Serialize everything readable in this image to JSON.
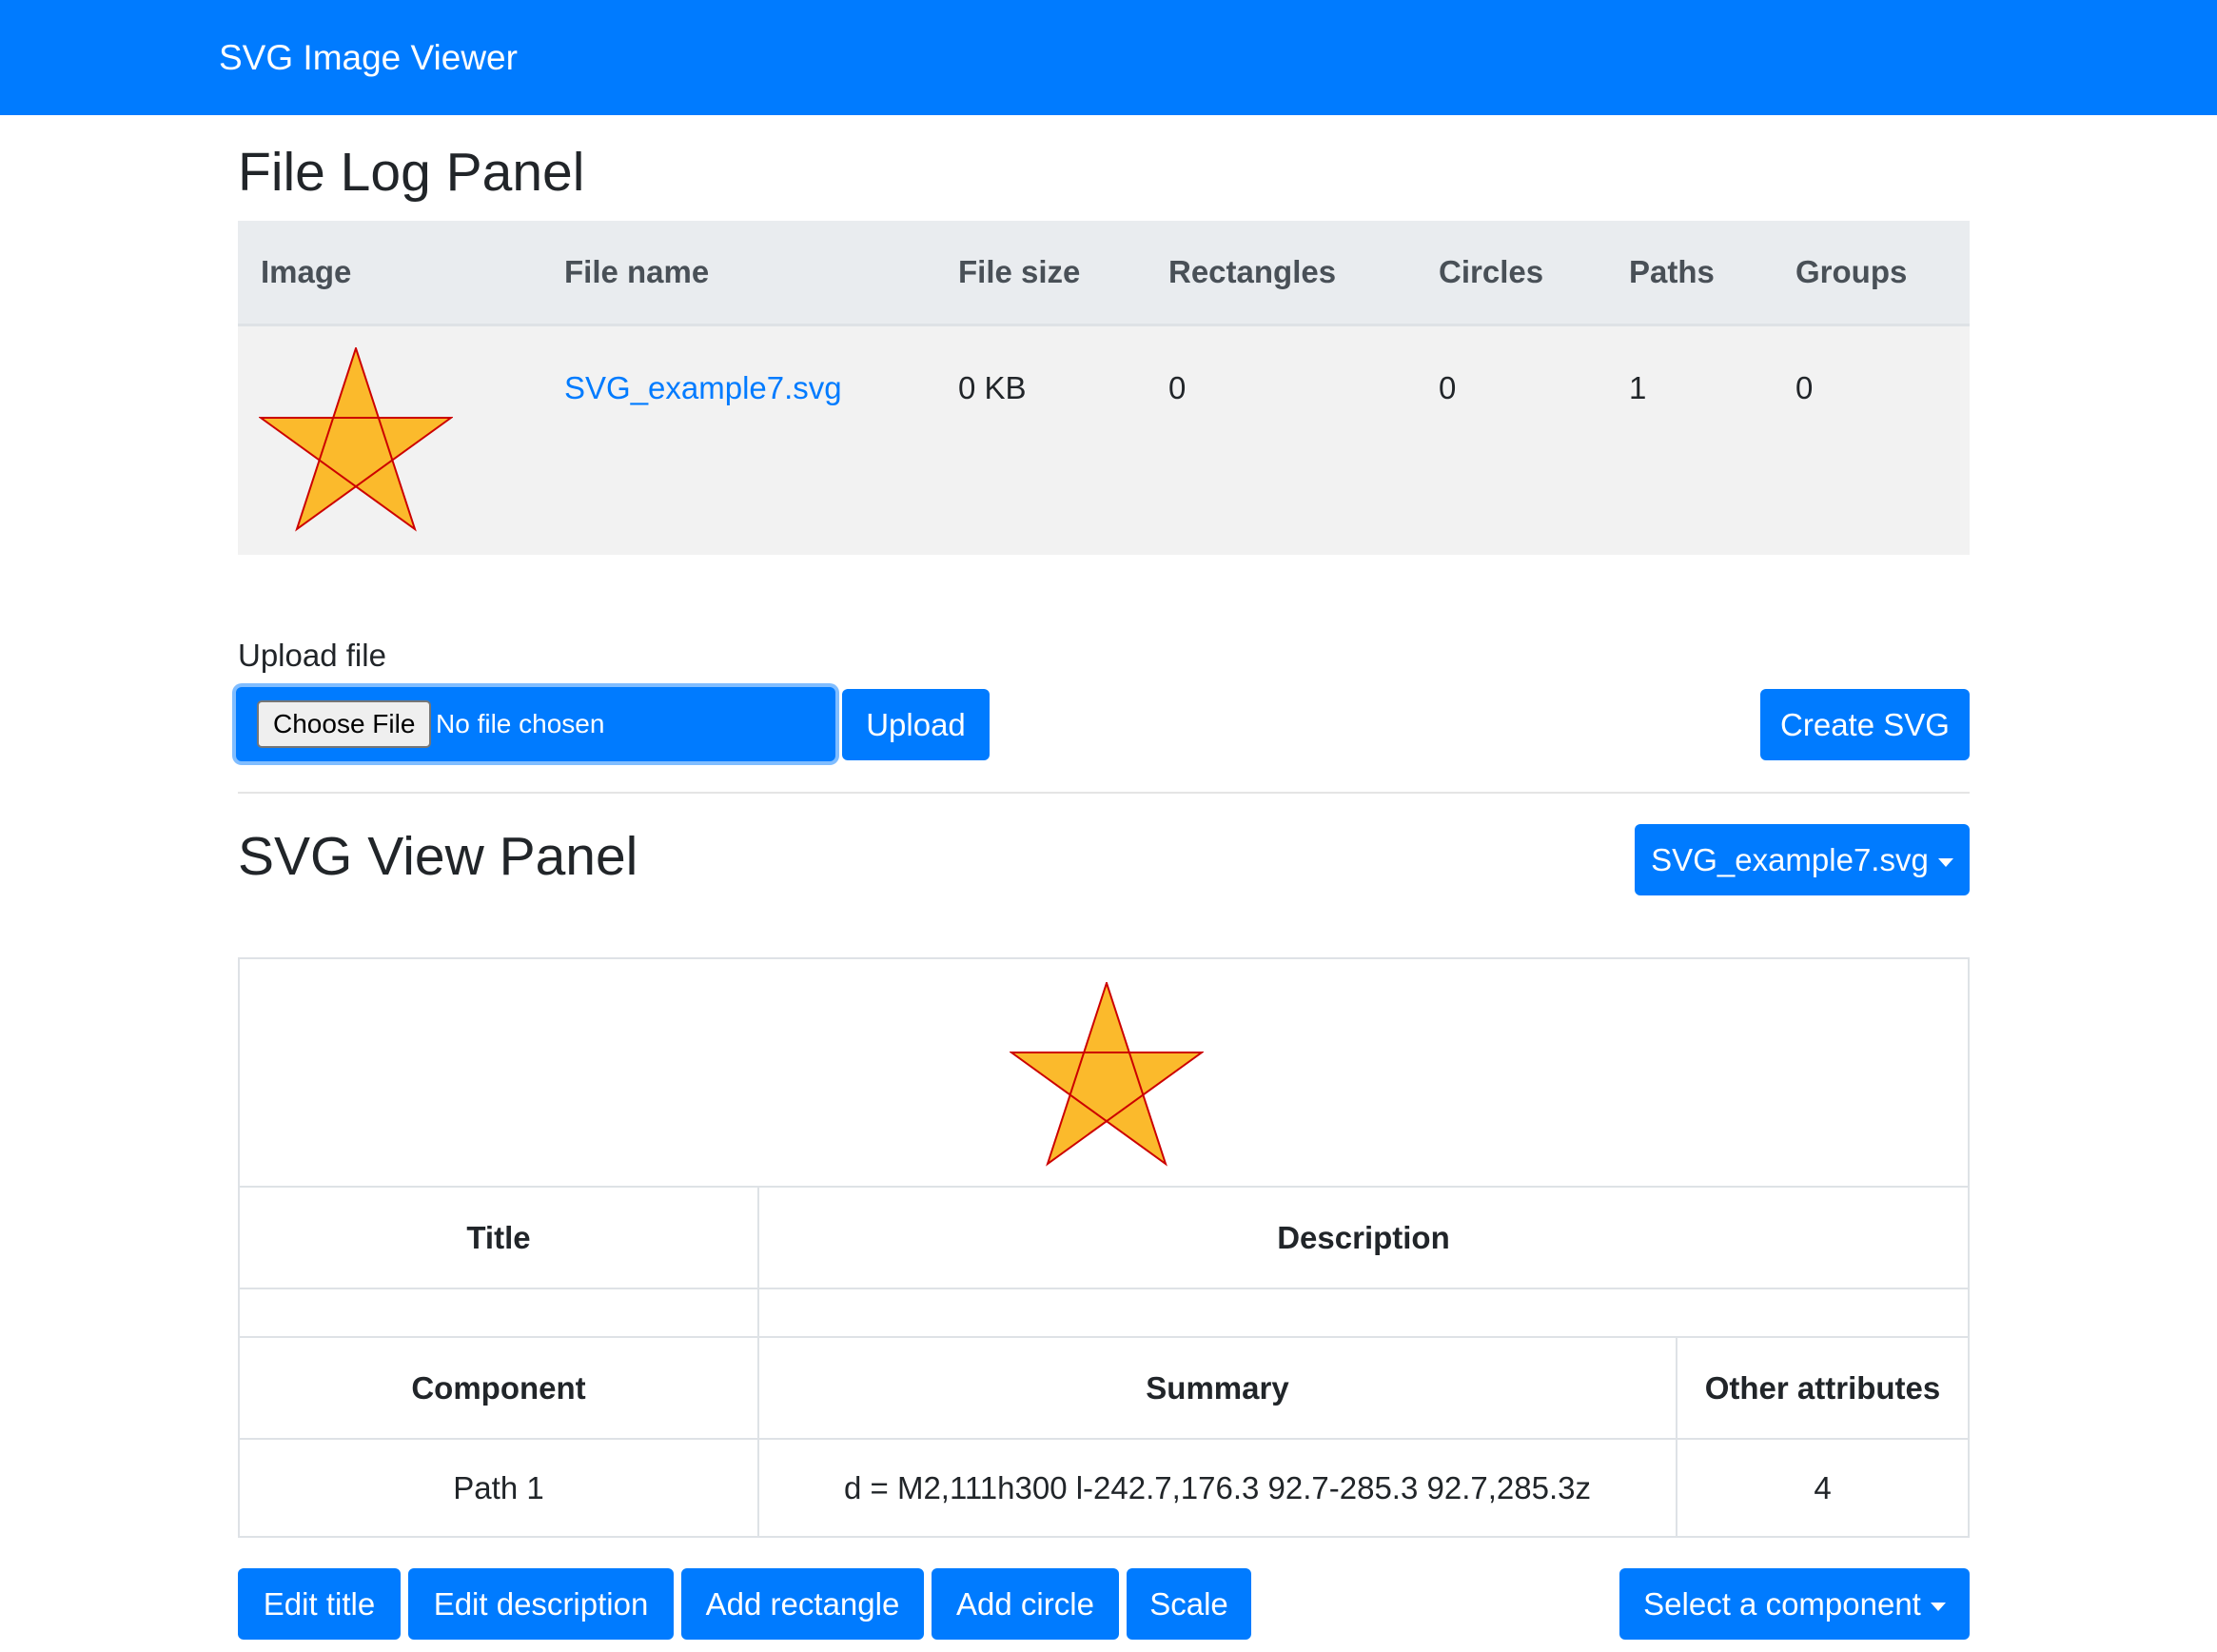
{
  "navbar": {
    "brand": "SVG Image Viewer"
  },
  "file_log": {
    "heading": "File Log Panel",
    "columns": [
      "Image",
      "File name",
      "File size",
      "Rectangles",
      "Circles",
      "Paths",
      "Groups"
    ],
    "rows": [
      {
        "file_name": "SVG_example7.svg",
        "file_size": "0 KB",
        "rectangles": "0",
        "circles": "0",
        "paths": "1",
        "groups": "0"
      }
    ]
  },
  "upload": {
    "label": "Upload file",
    "choose_label": "Choose File",
    "status": "No file chosen",
    "upload_label": "Upload",
    "create_label": "Create SVG"
  },
  "view_panel": {
    "heading": "SVG View Panel",
    "file_select": "SVG_example7.svg",
    "title_header": "Title",
    "description_header": "Description",
    "title_value": "",
    "description_value": "",
    "component_header": "Component",
    "summary_header": "Summary",
    "other_header": "Other attributes",
    "components": [
      {
        "name": "Path 1",
        "summary": "d = M2,111h300 l-242.7,176.3 92.7-285.3 92.7,285.3z",
        "other": "4"
      }
    ]
  },
  "actions": {
    "edit_title": "Edit title",
    "edit_description": "Edit description",
    "add_rectangle": "Add rectangle",
    "add_circle": "Add circle",
    "scale": "Scale",
    "select_component": "Select a component"
  },
  "colors": {
    "primary": "#007bff",
    "star_fill": "#fbba2c",
    "star_stroke": "#cc0000"
  }
}
